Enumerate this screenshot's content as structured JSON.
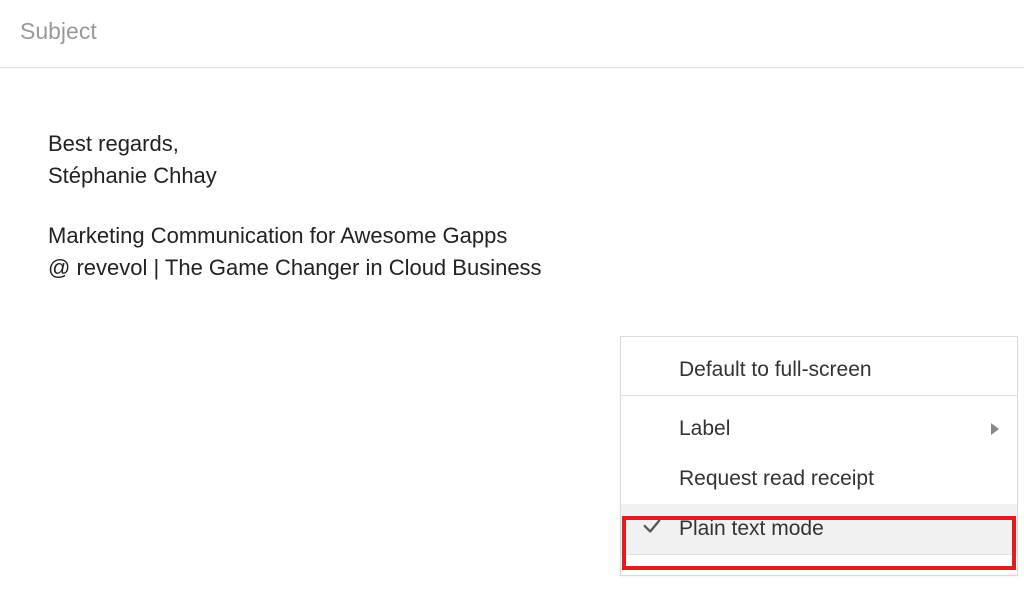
{
  "compose": {
    "subject_placeholder": "Subject",
    "body": {
      "line1": "Best regards,",
      "line2": "Stéphanie Chhay",
      "line3": "Marketing Communication for Awesome Gapps",
      "line4": "@ revevol | The Game Changer in Cloud Business"
    }
  },
  "menu": {
    "default_fullscreen": "Default to full-screen",
    "label": "Label",
    "request_receipt": "Request read receipt",
    "plain_text": "Plain text mode"
  }
}
